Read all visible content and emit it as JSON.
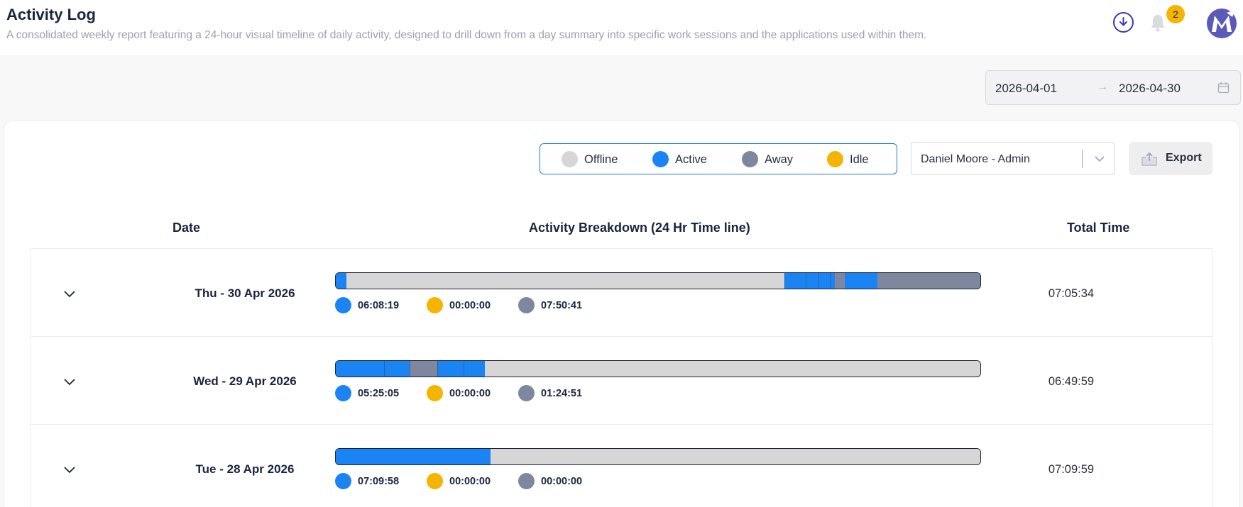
{
  "header": {
    "title": "Activity Log",
    "subtitle": "A consolidated weekly report featuring a 24-hour visual timeline of daily activity, designed to drill down from a day summary into specific work sessions and the applications used within them.",
    "notification_count": "2",
    "icons": [
      "download-icon",
      "bell-icon",
      "logo-avatar"
    ]
  },
  "date_range": {
    "start": "2026-04-01",
    "end": "2026-04-30",
    "arrow": "→"
  },
  "legend": [
    {
      "label": "Offline",
      "color": "#d6d6d6"
    },
    {
      "label": "Active",
      "color": "#1a84f5"
    },
    {
      "label": "Away",
      "color": "#7f879f"
    },
    {
      "label": "Idle",
      "color": "#f4b400"
    }
  ],
  "user_select": {
    "value": "Daniel Moore - Admin"
  },
  "export": {
    "label": "Export"
  },
  "table": {
    "headers": {
      "date": "Date",
      "breakdown": "Activity Breakdown (24 Hr Time line)",
      "total": "Total Time"
    },
    "rows": [
      {
        "date": "Thu - 30 Apr 2026",
        "active": "06:08:19",
        "idle": "00:00:00",
        "away": "07:50:41",
        "total": "07:05:34",
        "timeline": [
          {
            "start": 0.0,
            "end": 0.016,
            "status": "active"
          },
          {
            "start": 0.016,
            "end": 0.696,
            "status": "offline"
          },
          {
            "start": 0.696,
            "end": 0.774,
            "status": "active"
          },
          {
            "start": 0.774,
            "end": 0.79,
            "status": "away"
          },
          {
            "start": 0.79,
            "end": 0.84,
            "status": "active"
          },
          {
            "start": 0.84,
            "end": 1.0,
            "status": "away"
          }
        ],
        "dividers": [
          0.696,
          0.729,
          0.749,
          0.767
        ]
      },
      {
        "date": "Wed - 29 Apr 2026",
        "active": "05:25:05",
        "idle": "00:00:00",
        "away": "01:24:51",
        "total": "06:49:59",
        "timeline": [
          {
            "start": 0.0,
            "end": 0.115,
            "status": "active"
          },
          {
            "start": 0.115,
            "end": 0.157,
            "status": "away"
          },
          {
            "start": 0.157,
            "end": 0.231,
            "status": "active"
          },
          {
            "start": 0.231,
            "end": 1.0,
            "status": "offline"
          }
        ],
        "dividers": [
          0.075,
          0.115,
          0.157,
          0.198
        ]
      },
      {
        "date": "Tue - 28 Apr 2026",
        "active": "07:09:58",
        "idle": "00:00:00",
        "away": "00:00:00",
        "total": "07:09:59",
        "timeline": [
          {
            "start": 0.0,
            "end": 0.24,
            "status": "active"
          },
          {
            "start": 0.24,
            "end": 1.0,
            "status": "offline"
          }
        ],
        "dividers": []
      }
    ]
  }
}
